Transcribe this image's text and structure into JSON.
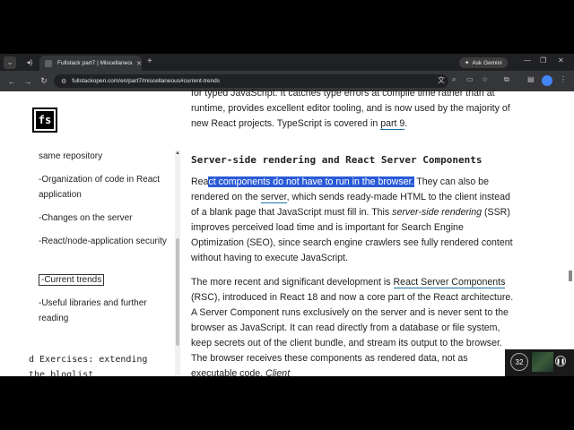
{
  "browser": {
    "tab_title": "Fullstack part7 | Miscellaneous",
    "url": "fullstackopen.com/en/part7/miscellaneous#current-trends",
    "gemini_label": "Ask Gemini"
  },
  "sidebar": {
    "logo": "fs",
    "items": [
      {
        "label": "same repository"
      },
      {
        "label": "-Organization of code in React application"
      },
      {
        "label": "-Changes on the server"
      },
      {
        "label": "-React/node-application security"
      },
      {
        "label": "-Current trends"
      },
      {
        "label": "-Useful libraries and further reading"
      }
    ],
    "section": "d Exercises: extending the bloglist"
  },
  "content": {
    "p0": {
      "a": "for typed JavaScript. It catches type errors at compile time rather than at runtime, provides excellent editor tooling, and is now used by the majority of new React projects. TypeScript is covered in ",
      "link": "part 9",
      "b": "."
    },
    "heading": "Server-side rendering and React Server Components",
    "p1": {
      "pre": "Rea",
      "selected": "ct components do not have to run in the browser.",
      "a": " They can also be rendered on the ",
      "link": "server",
      "b": ", which sends ready-made HTML to the client instead of a blank page that JavaScript must fill in. This ",
      "em": "server-side rendering",
      "c": " (SSR) improves perceived load time and is important for Search Engine Optimization (SEO), since search engine crawlers see fully rendered content without having to execute JavaScript."
    },
    "p2": {
      "a": "The more recent and significant development is ",
      "link": "React Server Components",
      "b": " (RSC), introduced in React 18 and now a core part of the React architecture. A Server Component runs exclusively on the server and is never sent to the browser as JavaScript. It can read directly from a database or file system, keep secrets out of the client bundle, and stream its output to the browser. The browser receives these components as rendered data, not as executable code. ",
      "em": "Client"
    }
  },
  "overlay": {
    "badge": "32"
  }
}
